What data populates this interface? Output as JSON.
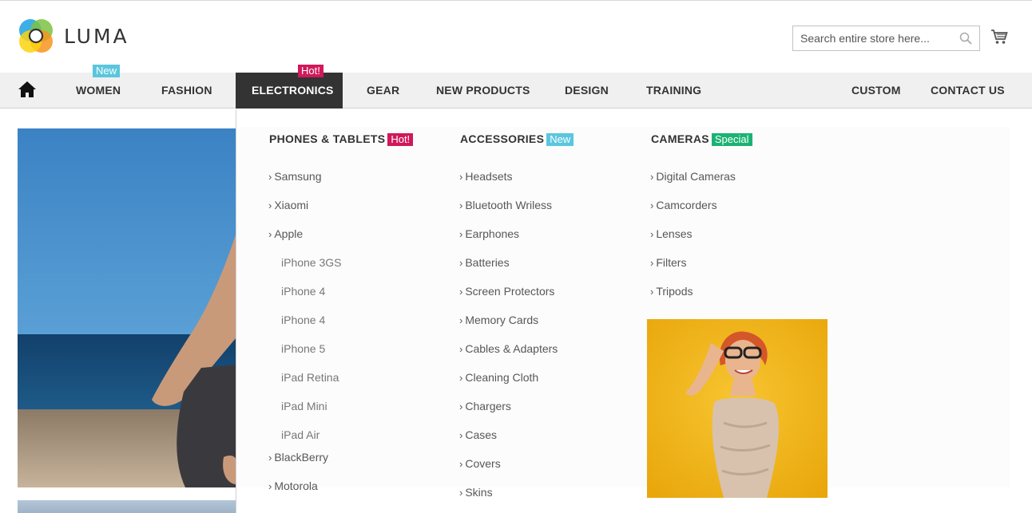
{
  "brand": {
    "name": "LUMA"
  },
  "search": {
    "placeholder": "Search entire store here..."
  },
  "icons": {
    "search": "search-icon",
    "cart": "cart-icon",
    "home": "home-icon"
  },
  "colors": {
    "nav_bg": "#f0f0f0",
    "active_nav_bg": "#333333",
    "new_badge": "#5bc6de",
    "hot_badge": "#d0185a",
    "special_badge": "#1bb272"
  },
  "nav": {
    "items": [
      {
        "label": "WOMEN",
        "badge": "New"
      },
      {
        "label": "FASHION"
      },
      {
        "label": "ELECTRONICS",
        "badge": "Hot!"
      },
      {
        "label": "GEAR"
      },
      {
        "label": "NEW PRODUCTS"
      },
      {
        "label": "DESIGN"
      },
      {
        "label": "TRAINING"
      },
      {
        "label": "CUSTOM"
      },
      {
        "label": "CONTACT US"
      }
    ]
  },
  "menu": {
    "columns": [
      {
        "title": "PHONES & TABLETS",
        "badge": "Hot!",
        "links": [
          "Samsung",
          "Xiaomi",
          "Apple"
        ],
        "sublinks": [
          "iPhone 3GS",
          "iPhone 4",
          "iPhone 4",
          "iPhone 5",
          "iPad Retina",
          "iPad Mini",
          "iPad Air"
        ],
        "links_after": [
          "BlackBerry",
          "Motorola"
        ]
      },
      {
        "title": "ACCESSORIES",
        "badge": "New",
        "links": [
          "Headsets",
          "Bluetooth Wriless",
          "Earphones",
          "Batteries",
          "Screen Protectors",
          "Memory Cards",
          "Cables & Adapters",
          "Cleaning Cloth",
          "Chargers",
          "Cases",
          "Covers",
          "Skins"
        ]
      },
      {
        "title": "CAMERAS",
        "badge": "Special",
        "links": [
          "Digital Cameras",
          "Camcorders",
          "Lenses",
          "Filters",
          "Tripods"
        ]
      }
    ]
  }
}
